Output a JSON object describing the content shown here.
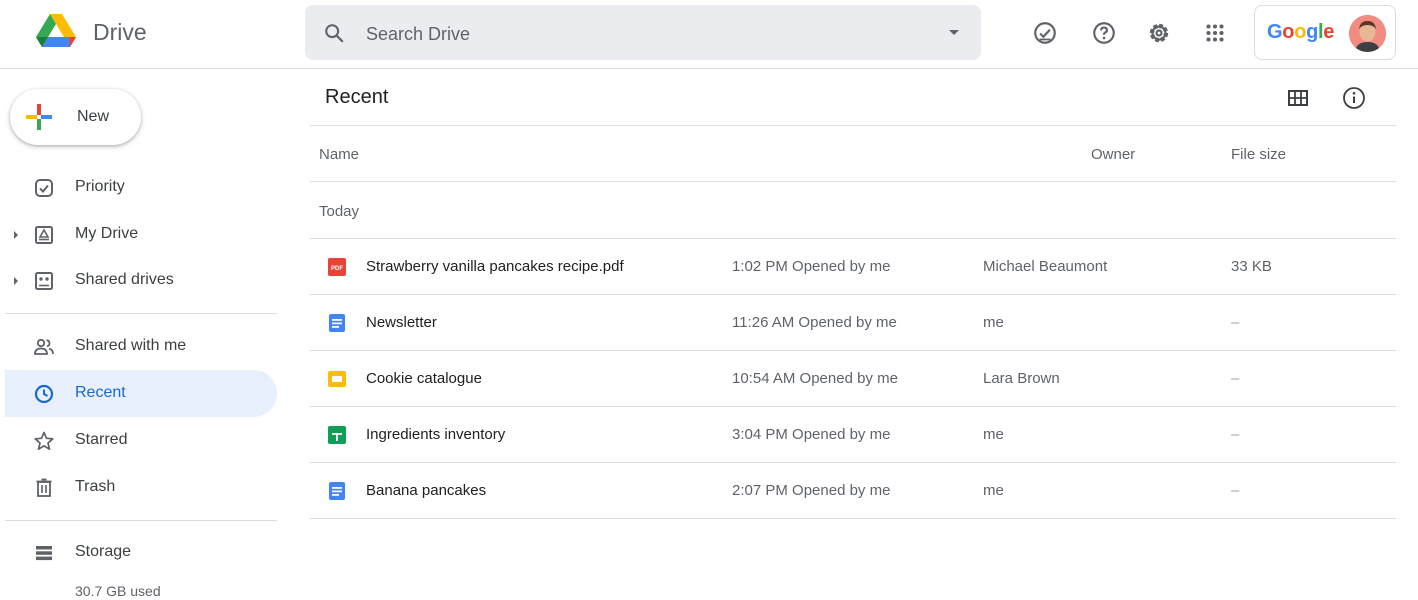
{
  "app": {
    "name": "Drive"
  },
  "search": {
    "placeholder": "Search Drive"
  },
  "header": {
    "icons": [
      "ready-for-offline-icon",
      "help-icon",
      "settings-icon",
      "apps-grid-icon"
    ],
    "account_brand": "Google"
  },
  "colors": {
    "blue": "#4285f4",
    "red": "#ea4335",
    "yellow": "#fbbc04",
    "green": "#34a853",
    "active_bg": "#e8f0fe",
    "active_text": "#1967d2",
    "pdf_red": "#ea4335",
    "docs_blue": "#4285f4",
    "slides_yellow": "#fbbc04",
    "sheets_green": "#0f9d58"
  },
  "sidebar": {
    "new_label": "New",
    "items": [
      {
        "label": "Priority",
        "icon": "priority-icon"
      },
      {
        "label": "My Drive",
        "icon": "my-drive-icon"
      },
      {
        "label": "Shared drives",
        "icon": "shared-drives-icon"
      },
      {
        "label": "Shared with me",
        "icon": "shared-with-me-icon"
      },
      {
        "label": "Recent",
        "icon": "clock-icon"
      },
      {
        "label": "Starred",
        "icon": "star-icon"
      },
      {
        "label": "Trash",
        "icon": "trash-icon"
      },
      {
        "label": "Storage",
        "icon": "storage-icon"
      }
    ],
    "storage_used": "30.7 GB used"
  },
  "main": {
    "title": "Recent",
    "columns": {
      "name": "Name",
      "owner": "Owner",
      "size": "File size"
    },
    "group": "Today",
    "files": [
      {
        "name": "Strawberry vanilla pancakes recipe.pdf",
        "type": "pdf",
        "time": "1:02 PM Opened by me",
        "owner": "Michael Beaumont",
        "size": "33 KB"
      },
      {
        "name": "Newsletter",
        "type": "doc",
        "time": "11:26 AM Opened by me",
        "owner": "me",
        "size": "–"
      },
      {
        "name": "Cookie catalogue",
        "type": "slides",
        "time": "10:54 AM Opened by me",
        "owner": "Lara Brown",
        "size": "–"
      },
      {
        "name": "Ingredients inventory",
        "type": "sheet",
        "time": "3:04 PM Opened by me",
        "owner": "me",
        "size": "–"
      },
      {
        "name": "Banana pancakes",
        "type": "doc",
        "time": "2:07 PM Opened by me",
        "owner": "me",
        "size": "–"
      }
    ]
  }
}
